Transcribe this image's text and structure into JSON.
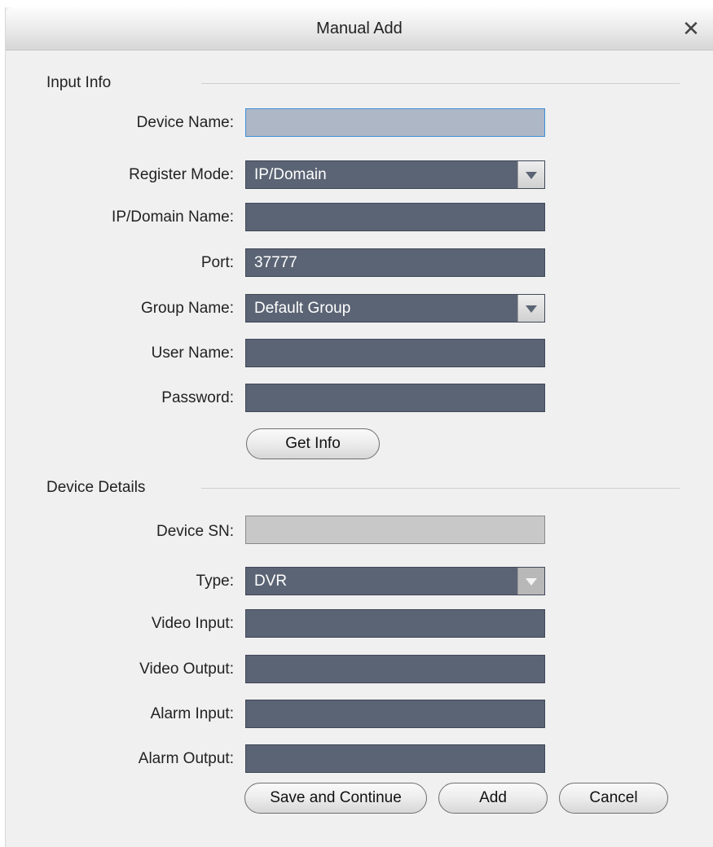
{
  "window": {
    "title": "Manual Add",
    "close_icon": "close-icon",
    "close_glyph": "✕"
  },
  "input_info": {
    "heading": "Input Info",
    "fields": {
      "device_name": {
        "label": "Device Name:",
        "value": ""
      },
      "register_mode": {
        "label": "Register Mode:",
        "value": "IP/Domain"
      },
      "ip_domain_name": {
        "label": "IP/Domain Name:",
        "value": ""
      },
      "port": {
        "label": "Port:",
        "value": "37777"
      },
      "group_name": {
        "label": "Group Name:",
        "value": "Default Group"
      },
      "user_name": {
        "label": "User Name:",
        "value": ""
      },
      "password": {
        "label": "Password:",
        "value": ""
      }
    },
    "get_info_button": "Get Info"
  },
  "device_details": {
    "heading": "Device Details",
    "fields": {
      "device_sn": {
        "label": "Device SN:",
        "value": ""
      },
      "type": {
        "label": "Type:",
        "value": "DVR"
      },
      "video_input": {
        "label": "Video Input:",
        "value": ""
      },
      "video_output": {
        "label": "Video Output:",
        "value": ""
      },
      "alarm_input": {
        "label": "Alarm Input:",
        "value": ""
      },
      "alarm_output": {
        "label": "Alarm Output:",
        "value": ""
      }
    }
  },
  "footer": {
    "save_continue_button": "Save and Continue",
    "add_button": "Add",
    "cancel_button": "Cancel"
  },
  "colors": {
    "field_bg": "#5b6474",
    "field_active_bg": "#aeb7c6",
    "field_active_border": "#3c8fd6",
    "field_disabled_bg": "#c8c8c8",
    "dialog_bg": "#f0f0f0"
  }
}
